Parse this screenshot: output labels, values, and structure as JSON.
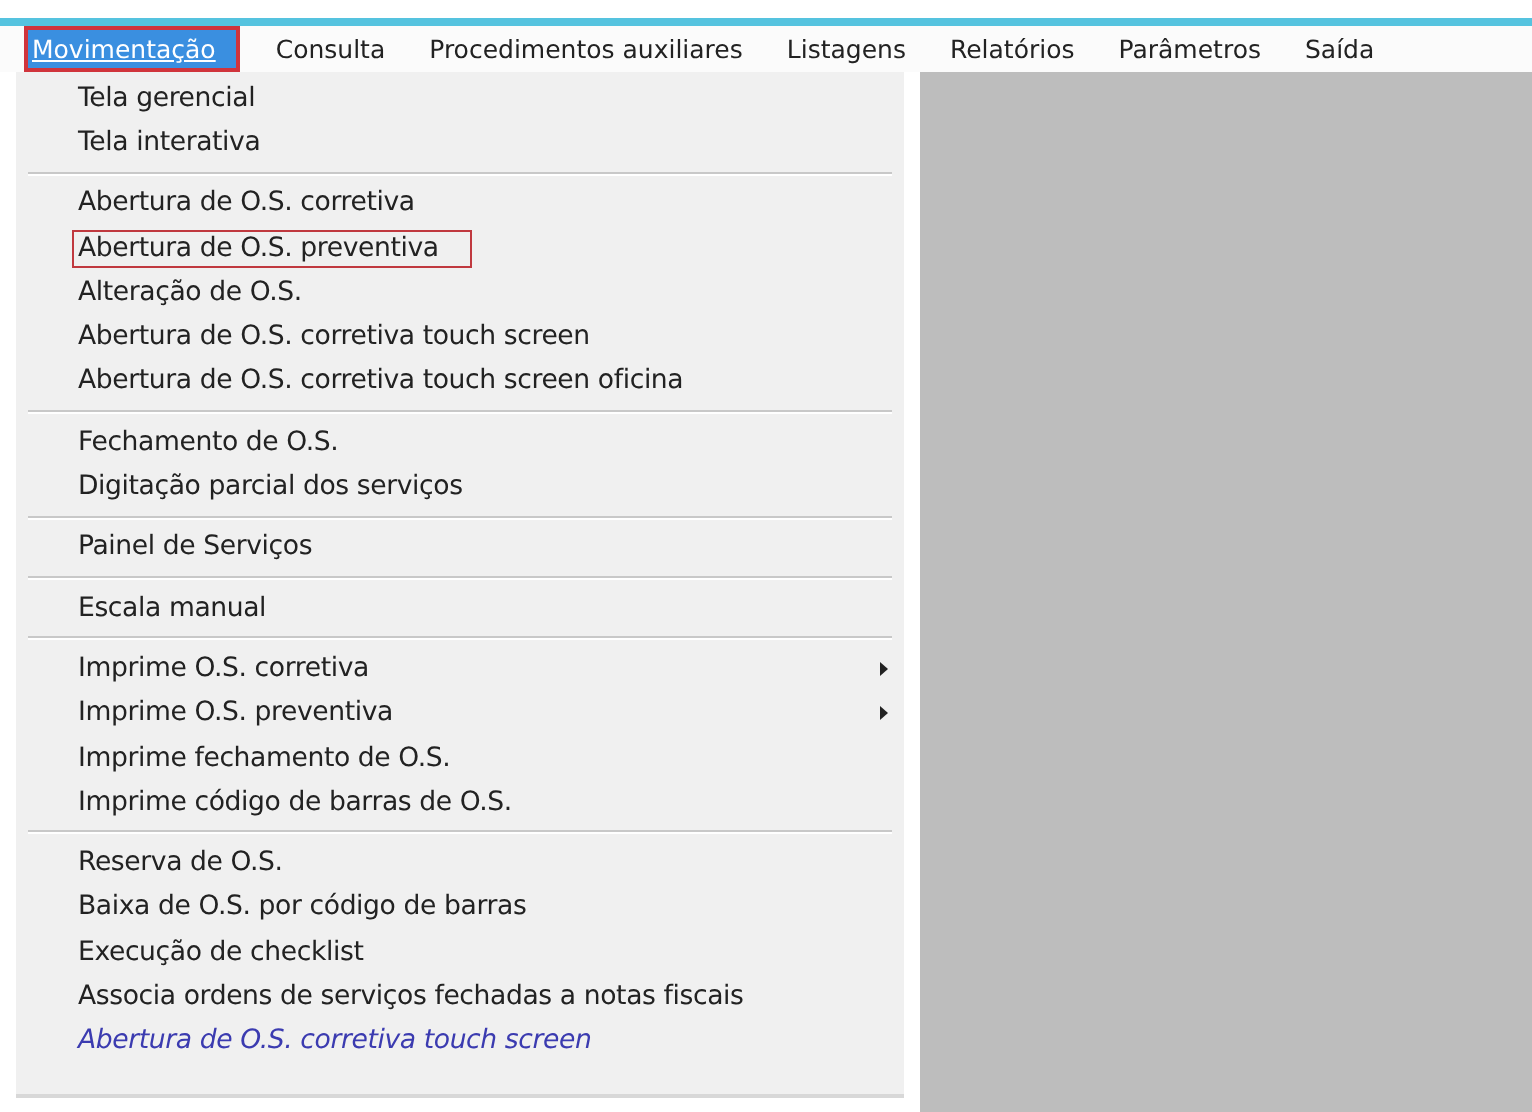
{
  "menubar": [
    {
      "label": "Movimentação",
      "selected": true,
      "outlined": true
    },
    {
      "label": "Consulta",
      "selected": false,
      "outlined": false
    },
    {
      "label": "Procedimentos auxiliares",
      "selected": false,
      "outlined": false
    },
    {
      "label": "Listagens",
      "selected": false,
      "outlined": false
    },
    {
      "label": "Relatórios",
      "selected": false,
      "outlined": false
    },
    {
      "label": "Parâmetros",
      "selected": false,
      "outlined": false
    },
    {
      "label": "Saída",
      "selected": false,
      "outlined": false
    }
  ],
  "menu": [
    {
      "kind": "item",
      "label": "Tela gerencial",
      "outlined": false,
      "submenu": false
    },
    {
      "kind": "item",
      "label": "Tela interativa",
      "outlined": false,
      "submenu": false
    },
    {
      "kind": "separator"
    },
    {
      "kind": "item",
      "label": "Abertura de O.S. corretiva",
      "outlined": false,
      "submenu": false
    },
    {
      "kind": "item",
      "label": "Abertura de O.S. preventiva",
      "outlined": true,
      "submenu": false
    },
    {
      "kind": "item",
      "label": "Alteração de O.S.",
      "outlined": false,
      "submenu": false
    },
    {
      "kind": "item",
      "label": "Abertura de O.S. corretiva touch screen",
      "outlined": false,
      "submenu": false
    },
    {
      "kind": "item",
      "label": "Abertura de O.S. corretiva touch screen oficina",
      "outlined": false,
      "submenu": false
    },
    {
      "kind": "separator"
    },
    {
      "kind": "item",
      "label": "Fechamento de O.S.",
      "outlined": false,
      "submenu": false
    },
    {
      "kind": "item",
      "label": "Digitação parcial dos serviços",
      "outlined": false,
      "submenu": false
    },
    {
      "kind": "separator"
    },
    {
      "kind": "item",
      "label": "Painel de Serviços",
      "outlined": false,
      "submenu": false
    },
    {
      "kind": "separator"
    },
    {
      "kind": "item",
      "label": "Escala manual",
      "outlined": false,
      "submenu": false
    },
    {
      "kind": "separator"
    },
    {
      "kind": "item",
      "label": "Imprime O.S. corretiva",
      "outlined": false,
      "submenu": true
    },
    {
      "kind": "item",
      "label": "Imprime O.S. preventiva",
      "outlined": false,
      "submenu": true
    },
    {
      "kind": "item",
      "label": "Imprime fechamento de O.S.",
      "outlined": false,
      "submenu": false
    },
    {
      "kind": "item",
      "label": "Imprime código de barras de O.S.",
      "outlined": false,
      "submenu": false
    },
    {
      "kind": "separator"
    },
    {
      "kind": "item",
      "label": "Reserva de O.S.",
      "outlined": false,
      "submenu": false
    },
    {
      "kind": "item",
      "label": "Baixa de O.S. por código de barras",
      "outlined": false,
      "submenu": false
    },
    {
      "kind": "item",
      "label": "Execução de checklist",
      "outlined": false,
      "submenu": false
    },
    {
      "kind": "item",
      "label": "Associa ordens de serviços fechadas a notas fiscais",
      "outlined": false,
      "submenu": false
    },
    {
      "kind": "link",
      "label": "Abertura de O.S. corretiva touch screen",
      "outlined": false,
      "submenu": false
    }
  ]
}
